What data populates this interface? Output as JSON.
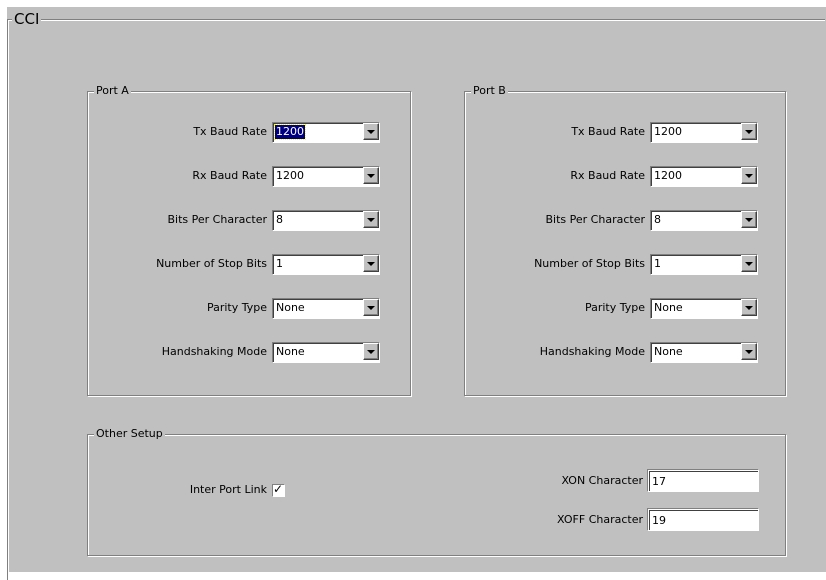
{
  "cci": {
    "title": "CCI"
  },
  "port_a": {
    "title": "Port A",
    "fields": [
      {
        "label": "Tx Baud Rate",
        "value": "1200",
        "focused": true
      },
      {
        "label": "Rx Baud Rate",
        "value": "1200"
      },
      {
        "label": "Bits Per Character",
        "value": "8"
      },
      {
        "label": "Number of Stop Bits",
        "value": "1"
      },
      {
        "label": "Parity Type",
        "value": "None"
      },
      {
        "label": "Handshaking Mode",
        "value": "None"
      }
    ]
  },
  "port_b": {
    "title": "Port B",
    "fields": [
      {
        "label": "Tx Baud Rate",
        "value": "1200"
      },
      {
        "label": "Rx Baud Rate",
        "value": "1200"
      },
      {
        "label": "Bits Per Character",
        "value": "8"
      },
      {
        "label": "Number of Stop Bits",
        "value": "1"
      },
      {
        "label": "Parity Type",
        "value": "None"
      },
      {
        "label": "Handshaking Mode",
        "value": "None"
      }
    ]
  },
  "other_setup": {
    "title": "Other Setup",
    "inter_port_link": {
      "label": "Inter Port Link",
      "checked": true,
      "check_glyph": "✓"
    },
    "xon": {
      "label": "XON Character",
      "value": "17"
    },
    "xoff": {
      "label": "XOFF Character",
      "value": "19"
    }
  }
}
